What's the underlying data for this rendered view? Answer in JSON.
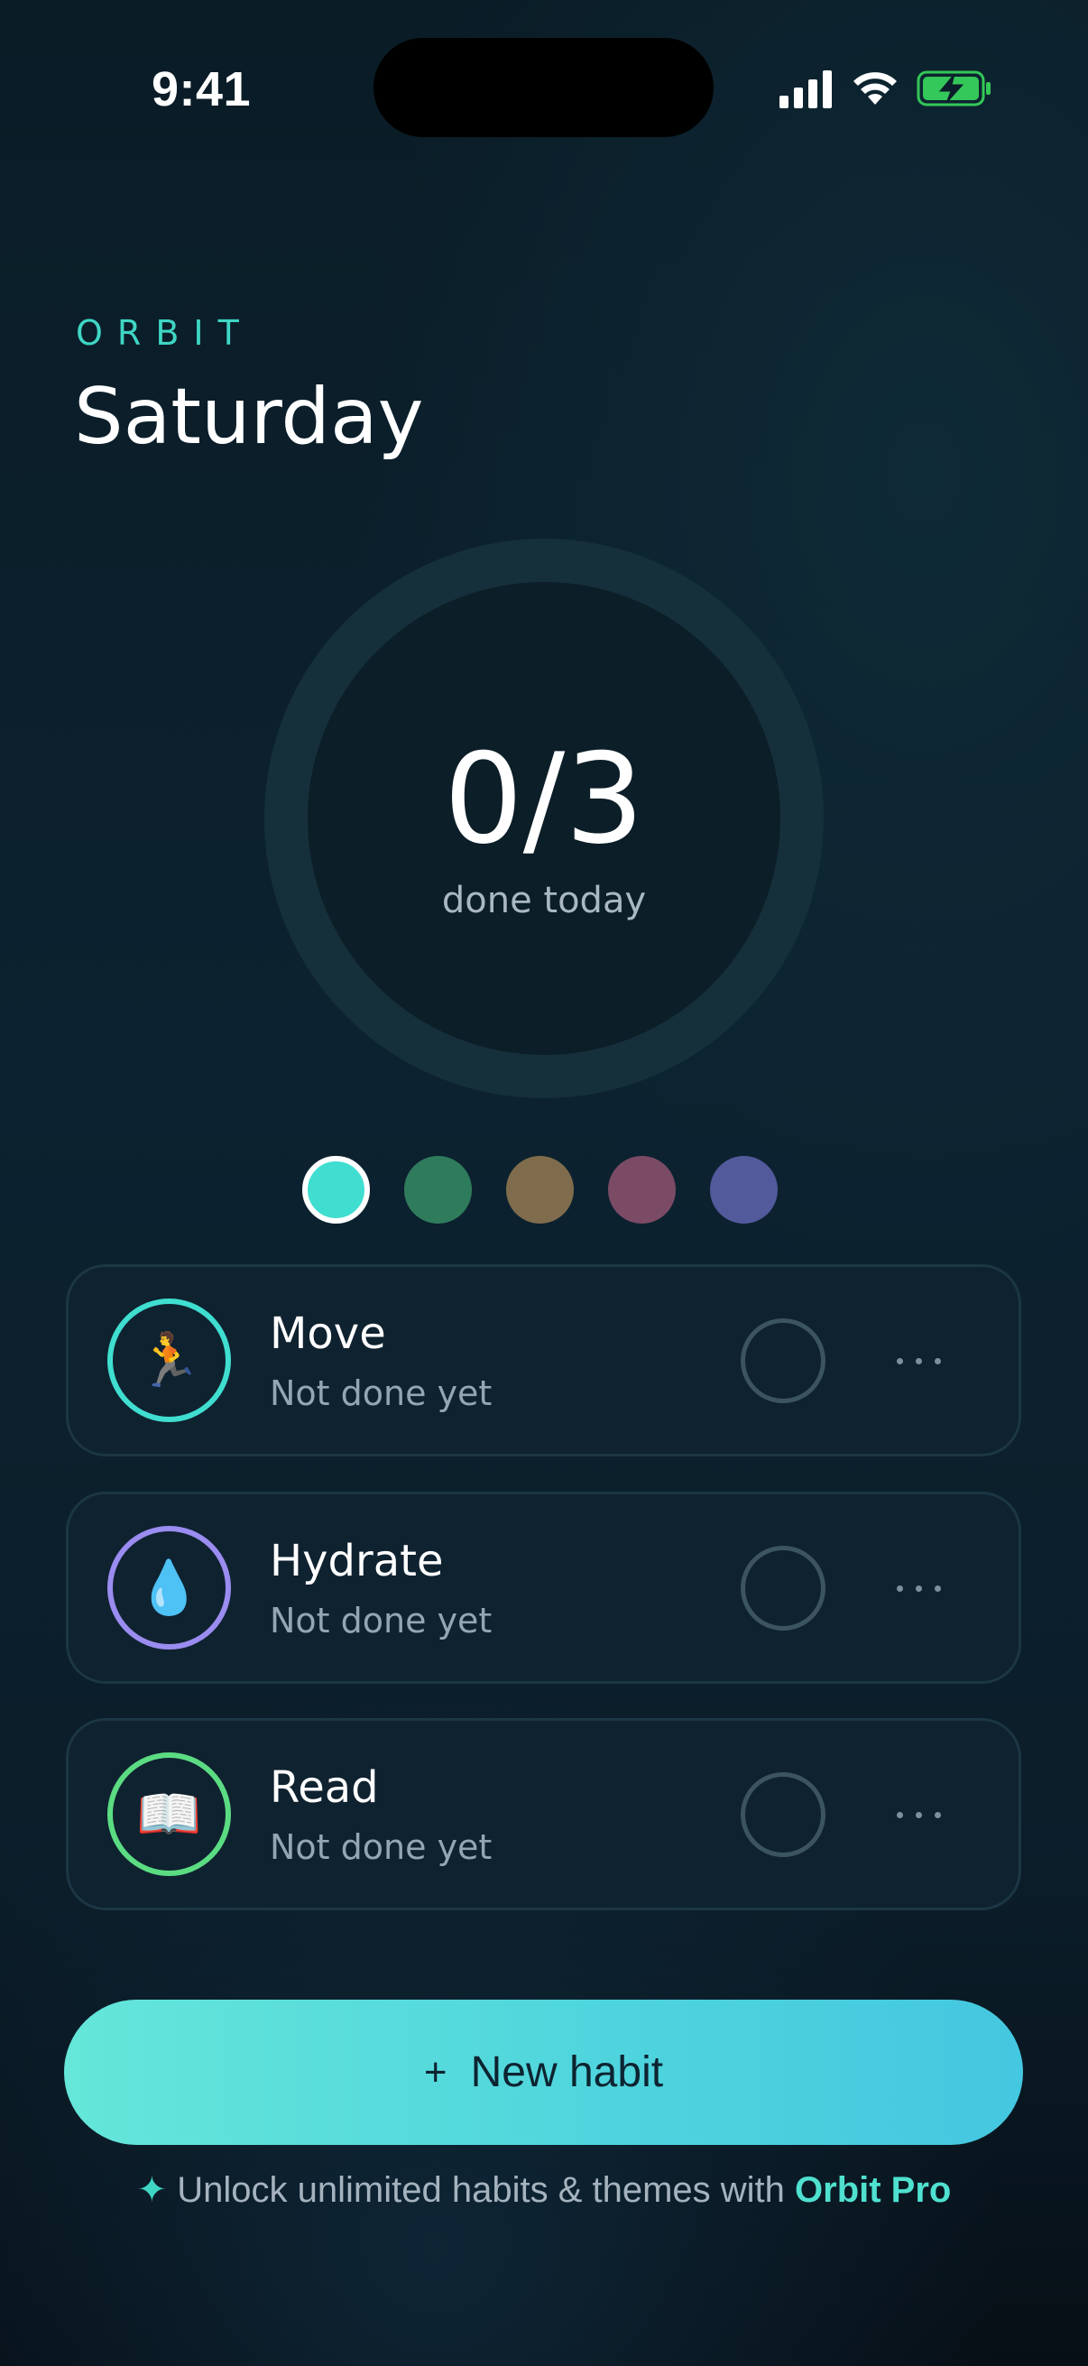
{
  "status_bar": {
    "time": "9:41"
  },
  "header": {
    "brand": "ORBIT",
    "day": "Saturday"
  },
  "progress": {
    "count": "0/3",
    "label": "done today",
    "done": 0,
    "total": 3
  },
  "themes": [
    {
      "color": "#3fded0",
      "selected": true
    },
    {
      "color": "#2f7c5c",
      "selected": false
    },
    {
      "color": "#7f6c4c",
      "selected": false
    },
    {
      "color": "#7b4b66",
      "selected": false
    },
    {
      "color": "#525a9c",
      "selected": false
    }
  ],
  "habits": [
    {
      "name": "Move",
      "status": "Not done yet",
      "emoji": "🏃",
      "icon": "runner-icon",
      "ring_color": "#3fded0"
    },
    {
      "name": "Hydrate",
      "status": "Not done yet",
      "emoji": "💧",
      "icon": "droplet-icon",
      "ring_color": "#9a8cf0"
    },
    {
      "name": "Read",
      "status": "Not done yet",
      "emoji": "📖",
      "icon": "book-icon",
      "ring_color": "#5bdc82"
    }
  ],
  "actions": {
    "new_habit_plus": "+",
    "new_habit_label": "New habit"
  },
  "promo": {
    "spark": "✦",
    "text": "Unlock unlimited habits & themes with ",
    "pro": "Orbit Pro"
  },
  "colors": {
    "accent": "#3fd6c4",
    "card_bg": "#0f2230",
    "button_gradient_start": "#65e6d9",
    "button_gradient_end": "#44c7e0"
  }
}
